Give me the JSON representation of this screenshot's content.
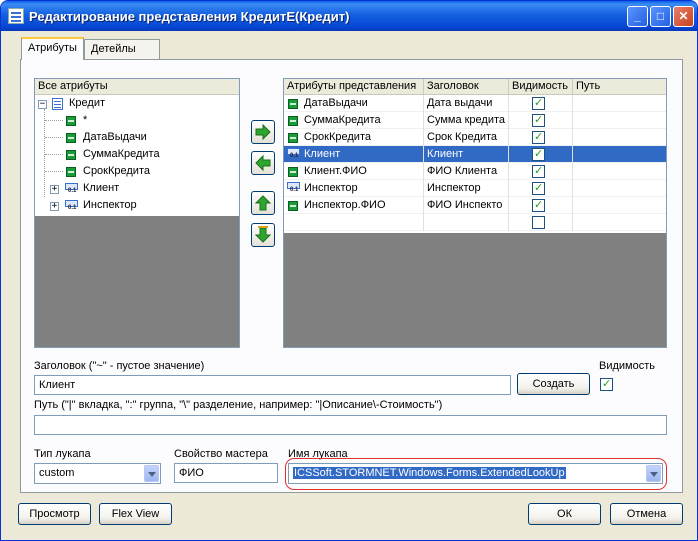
{
  "window": {
    "title": "Редактирование представления КредитЕ(Кредит)",
    "min_glyph": "_",
    "max_glyph": "□",
    "close_glyph": "✕"
  },
  "tabs": [
    {
      "label": "Атрибуты",
      "active": true
    },
    {
      "label": "Детейлы",
      "active": false
    }
  ],
  "all_attributes": {
    "header": "Все атрибуты",
    "root": {
      "label": "Кредит",
      "expander": "−",
      "icon": "table-icon"
    },
    "items": [
      {
        "label": "*",
        "icon": "attribute-icon"
      },
      {
        "label": "ДатаВыдачи",
        "icon": "attribute-icon"
      },
      {
        "label": "СуммаКредита",
        "icon": "attribute-icon"
      },
      {
        "label": "СрокКредита",
        "icon": "attribute-icon"
      },
      {
        "label": "Клиент",
        "icon": "lookup-icon",
        "expander": "+"
      },
      {
        "label": "Инспектор",
        "icon": "lookup-icon",
        "expander": "+"
      }
    ]
  },
  "view_attributes": {
    "columns": [
      "Атрибуты представления",
      "Заголовок",
      "Видимость",
      "Путь"
    ],
    "rows": [
      {
        "attr": "ДатаВыдачи",
        "caption": "Дата выдачи",
        "visible": true,
        "path": "",
        "icon": "attribute-icon"
      },
      {
        "attr": "СуммаКредита",
        "caption": "Сумма кредита",
        "visible": true,
        "path": "",
        "icon": "attribute-icon"
      },
      {
        "attr": "СрокКредита",
        "caption": "Срок Кредита",
        "visible": true,
        "path": "",
        "icon": "attribute-icon"
      },
      {
        "attr": "Клиент",
        "caption": "Клиент",
        "visible": true,
        "path": "",
        "icon": "lookup-icon",
        "selected": true
      },
      {
        "attr": "Клиент.ФИО",
        "caption": "ФИО Клиента",
        "visible": true,
        "path": "",
        "icon": "attribute-icon"
      },
      {
        "attr": "Инспектор",
        "caption": "Инспектор",
        "visible": true,
        "path": "",
        "icon": "lookup-icon"
      },
      {
        "attr": "Инспектор.ФИО",
        "caption": "ФИО Инспекто",
        "visible": true,
        "path": "",
        "icon": "attribute-icon"
      },
      {
        "attr": "",
        "caption": "",
        "visible": false,
        "path": "",
        "icon": ""
      }
    ]
  },
  "form": {
    "caption_label": "Заголовок (\"~\" - пустое значение)",
    "caption_value": "Клиент",
    "create_button": "Создать",
    "visibility_label": "Видимость",
    "visibility_checked": true,
    "path_label": "Путь (\"|\" вкладка, \":\" группа, \"\\\" разделение, например: \"|Описание\\-Стоимость\")",
    "path_value": "",
    "lookup_type_label": "Тип лукапа",
    "lookup_type_value": "custom",
    "master_prop_label": "Свойство мастера",
    "master_prop_value": "ФИО",
    "lookup_name_label": "Имя лукапа",
    "lookup_name_value": "ICSSoft.STORMNET.Windows.Forms.ExtendedLookUp"
  },
  "footer": {
    "preview_button": "Просмотр",
    "flexview_button": "Flex View",
    "ok_button": "ОК",
    "cancel_button": "Отмена"
  },
  "colors": {
    "title_bar": "#0a5fe6",
    "selection": "#316ac5",
    "highlight_outline": "#e03030",
    "arrow_green": "#2ea52e"
  }
}
